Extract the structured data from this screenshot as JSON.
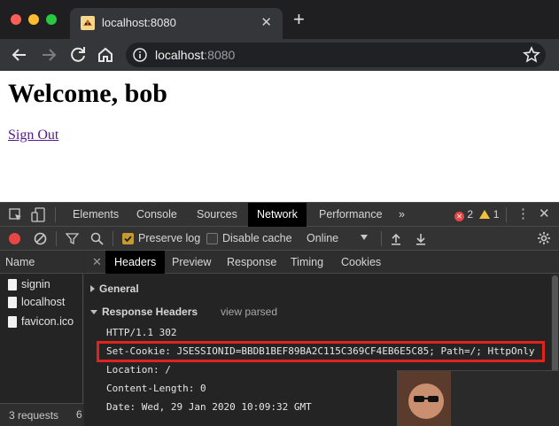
{
  "browser": {
    "tab_title": "localhost:8080",
    "url_host": "localhost",
    "url_port": ":8080"
  },
  "page": {
    "heading": "Welcome, bob",
    "signout_link": "Sign Out"
  },
  "devtools": {
    "tabs": [
      "Elements",
      "Console",
      "Sources",
      "Network",
      "Performance"
    ],
    "more": "»",
    "errors": "2",
    "warnings": "1",
    "preserve_log": "Preserve log",
    "disable_cache": "Disable cache",
    "throttle": "Online",
    "requests_header": "Name",
    "requests": [
      "signin",
      "localhost",
      "favicon.ico"
    ],
    "requests_footer": "3 requests",
    "requests_footer_extra": "6",
    "detail_tabs": [
      "Headers",
      "Preview",
      "Response",
      "Timing",
      "Cookies"
    ],
    "general": "General",
    "response_headers": "Response Headers",
    "view_parsed": "view parsed",
    "headers": [
      "HTTP/1.1 302",
      "Set-Cookie: JSESSIONID=BBDB1BEF89BA2C115C369CF4EB6E5C85; Path=/; HttpOnly",
      "Location: /",
      "Content-Length: 0",
      "Date: Wed, 29 Jan 2020 10:09:32 GMT"
    ]
  },
  "colors": {
    "highlight": "#e0241c",
    "record": "#e64646",
    "link": "#551a8b"
  }
}
